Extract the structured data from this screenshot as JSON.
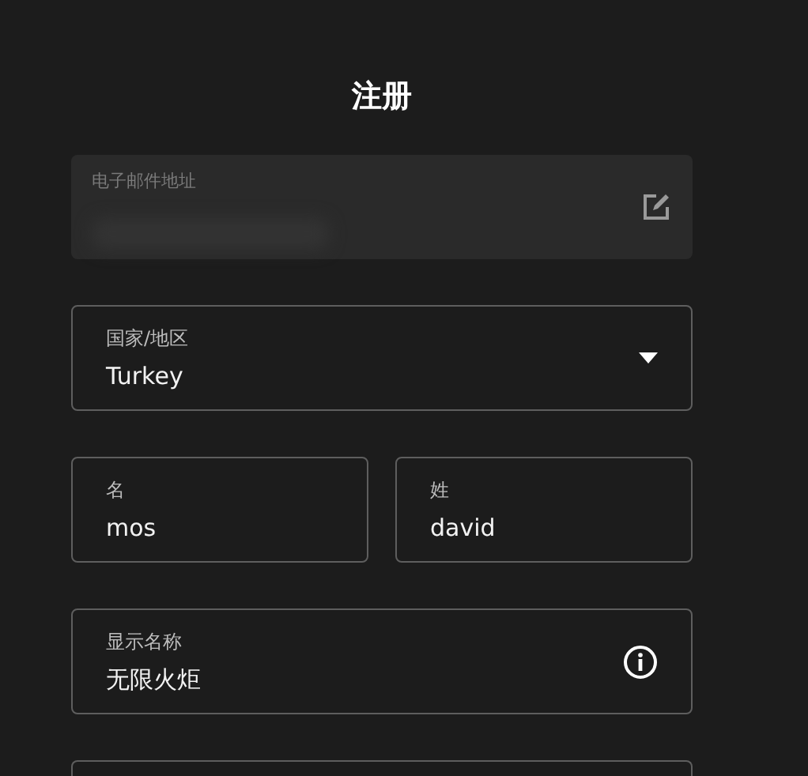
{
  "title": "注册",
  "fields": [
    {
      "kind": "locked",
      "label": "电子邮件地址",
      "disabled": true
    },
    {
      "kind": "select",
      "label": "国家/地区",
      "value": "Turkey"
    },
    {
      "kind": "pair",
      "items": [
        {
          "label": "名",
          "value": "mos"
        },
        {
          "label": "姓",
          "value": "david"
        }
      ]
    },
    {
      "kind": "info",
      "label": "显示名称",
      "value": "无限火炬"
    },
    {
      "kind": "partial"
    }
  ]
}
